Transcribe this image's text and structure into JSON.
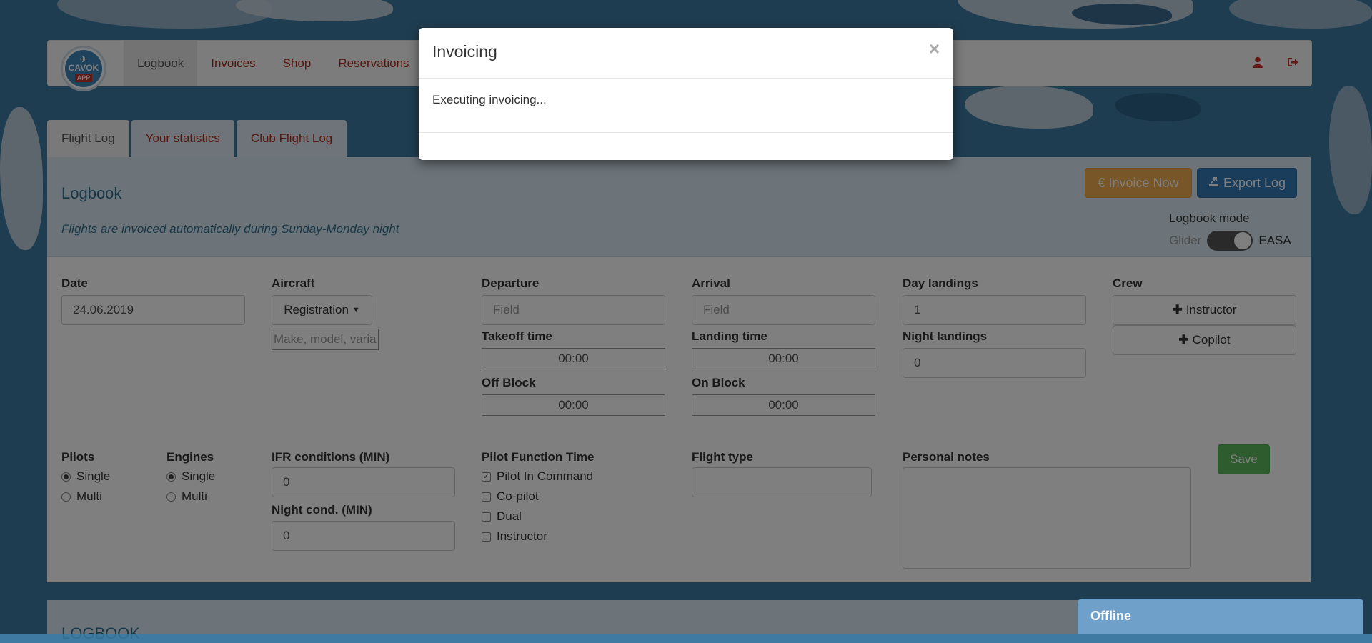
{
  "navbar": {
    "logo_text": "CAVOK",
    "logo_sub": "APP",
    "items": [
      {
        "label": "Logbook",
        "active": true
      },
      {
        "label": "Invoices"
      },
      {
        "label": "Shop"
      },
      {
        "label": "Reservations"
      }
    ],
    "right_icons": [
      "user-icon",
      "logout-icon"
    ]
  },
  "tabs": [
    {
      "label": "Flight Log",
      "active": true
    },
    {
      "label": "Your statistics"
    },
    {
      "label": "Club Flight Log"
    }
  ],
  "logbook": {
    "title": "Logbook",
    "note": "Flights are invoiced automatically during Sunday-Monday night",
    "invoice_button": "Invoice Now",
    "export_button": "Export Log",
    "mode_label": "Logbook mode",
    "mode_left": "Glider",
    "mode_right": "EASA",
    "mode_value": "EASA"
  },
  "form": {
    "date_label": "Date",
    "date_value": "24.06.2019",
    "aircraft_label": "Aircraft",
    "registration_button": "Registration",
    "aircraft_placeholder": "Make, model, varia",
    "departure_label": "Departure",
    "departure_placeholder": "Field",
    "arrival_label": "Arrival",
    "arrival_placeholder": "Field",
    "takeoff_label": "Takeoff time",
    "takeoff_value": "00:00",
    "landing_label": "Landing time",
    "landing_value": "00:00",
    "offblock_label": "Off Block",
    "offblock_value": "00:00",
    "onblock_label": "On Block",
    "onblock_value": "00:00",
    "day_landings_label": "Day landings",
    "day_landings_value": "1",
    "night_landings_label": "Night landings",
    "night_landings_value": "0",
    "crew_label": "Crew",
    "instructor_button": "Instructor",
    "copilot_button": "Copilot",
    "pilots_label": "Pilots",
    "pilots_options": [
      "Single",
      "Multi"
    ],
    "pilots_selected": "Single",
    "engines_label": "Engines",
    "engines_options": [
      "Single",
      "Multi"
    ],
    "engines_selected": "Single",
    "ifr_label": "IFR conditions (MIN)",
    "ifr_value": "0",
    "night_label": "Night cond. (MIN)",
    "night_value": "0",
    "pft_label": "Pilot Function Time",
    "pft_options": [
      {
        "label": "Pilot In Command",
        "checked": true
      },
      {
        "label": "Co-pilot",
        "checked": false
      },
      {
        "label": "Dual",
        "checked": false
      },
      {
        "label": "Instructor",
        "checked": false
      }
    ],
    "flight_type_label": "Flight type",
    "flight_type_value": "",
    "notes_label": "Personal notes",
    "notes_value": "",
    "save_button": "Save"
  },
  "section2_title": "LOGBOOK",
  "chat": {
    "status": "Offline"
  },
  "modal": {
    "title": "Invoicing",
    "close": "×",
    "body": "Executing invoicing..."
  }
}
